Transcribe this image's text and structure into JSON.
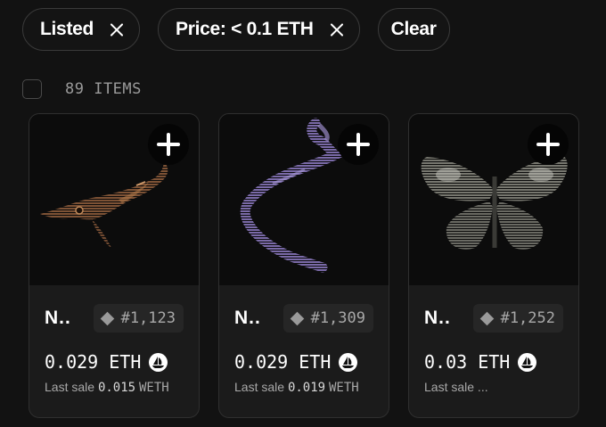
{
  "filters": {
    "chips": [
      {
        "label": "Listed"
      },
      {
        "label": "Price: < 0.1 ETH"
      }
    ],
    "clear_label": "Clear"
  },
  "items_count": "89 ITEMS",
  "cards": [
    {
      "name": "N..",
      "token_id": "#1,123",
      "price": "0.029 ETH",
      "last_sale_label": "Last sale",
      "last_sale_value": "0.015",
      "last_sale_currency": "WETH",
      "art": "brown-whale-sketch"
    },
    {
      "name": "N..",
      "token_id": "#1,309",
      "price": "0.029 ETH",
      "last_sale_label": "Last sale",
      "last_sale_value": "0.019",
      "last_sale_currency": "WETH",
      "art": "purple-squiggle"
    },
    {
      "name": "N..",
      "token_id": "#1,252",
      "price": "0.03 ETH",
      "last_sale_label": "Last sale ...",
      "last_sale_value": "",
      "last_sale_currency": "",
      "art": "grey-butterfly"
    }
  ],
  "icons": {
    "add": "plus-icon",
    "remove_filter": "close-icon",
    "chain": "diamond-icon",
    "marketplace": "opensea-icon"
  },
  "colors": {
    "background": "#121212",
    "card": "#1b1b1b",
    "chip_border": "#3a3a3a",
    "opensea": "#ffffff"
  }
}
